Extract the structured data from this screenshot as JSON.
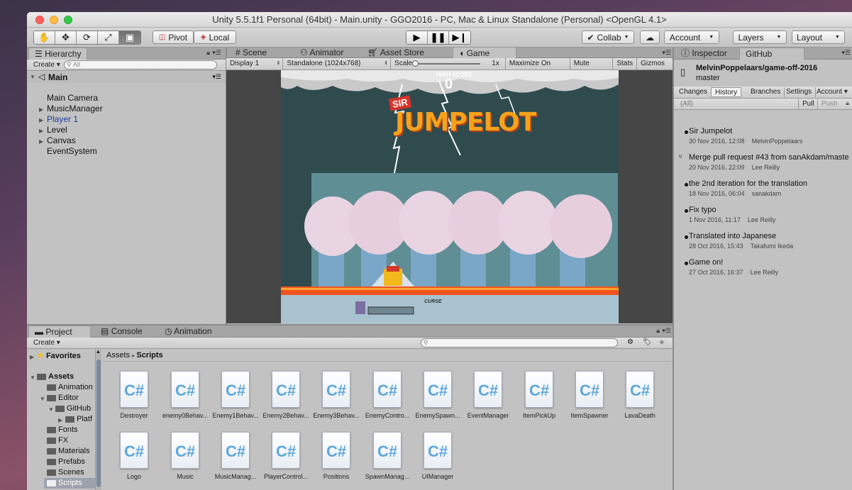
{
  "window": {
    "title": "Unity 5.5.1f1 Personal (64bit) - Main.unity - GGO2016 - PC, Mac & Linux Standalone (Personal) <OpenGL 4.1>"
  },
  "toolbar": {
    "pivot": "Pivot",
    "local": "Local",
    "collab": "Collab",
    "account": "Account",
    "layers": "Layers",
    "layout": "Layout"
  },
  "hierarchy": {
    "tab": "Hierarchy",
    "create": "Create",
    "search_placeholder": "All",
    "scene": "Main",
    "items": [
      {
        "label": "Main Camera"
      },
      {
        "label": "MusicManager"
      },
      {
        "label": "Player 1"
      },
      {
        "label": "Level"
      },
      {
        "label": "Canvas"
      },
      {
        "label": "EventSystem"
      }
    ]
  },
  "center_tabs": {
    "scene": "Scene",
    "animator": "Animator",
    "asset_store": "Asset Store",
    "game": "Game"
  },
  "game_bar": {
    "display": "Display 1",
    "resolution": "Standalone (1024x768)",
    "scale_label": "Scale",
    "scale_value": "1x",
    "maximize": "Maximize On Play",
    "mute": "Mute Audio",
    "stats": "Stats",
    "gizmos": "Gizmos"
  },
  "game_view": {
    "high_score_label": "HIGH SCORE",
    "high_score": "0",
    "title_small": "SIR",
    "title_big": "JUMPELOT",
    "curse_label": "CURSE"
  },
  "right_tabs": {
    "inspector": "Inspector",
    "github": "GitHub"
  },
  "github": {
    "repo": "MelvinPoppelaars/game-off-2016",
    "branch": "master",
    "tabs": [
      "Changes",
      "History",
      "Branches",
      "Settings"
    ],
    "account": "Account",
    "filter": "(All)",
    "pull": "Pull",
    "push": "Push",
    "commits": [
      {
        "message": "Sir Jumpelot",
        "date": "30 Nov 2016, 12:08",
        "author": "MelvinPoppelaars"
      },
      {
        "message": "Merge pull request #43 from sanAkdam/maste",
        "date": "20 Nov 2016, 22:09",
        "author": "Lee Reilly"
      },
      {
        "message": "the 2nd iteration for the translation",
        "date": "18 Nov 2016, 06:04",
        "author": "sanakdam"
      },
      {
        "message": "Fix typo",
        "date": "1 Nov 2016, 11:17",
        "author": "Lee Reilly"
      },
      {
        "message": "Translated into Japanese",
        "date": "28 Oct 2016, 15:43",
        "author": "Takafumi Ikeda"
      },
      {
        "message": "Game on!",
        "date": "27 Oct 2016, 16:37",
        "author": "Lee Reilly"
      }
    ]
  },
  "bottom_tabs": {
    "project": "Project",
    "console": "Console",
    "animation": "Animation"
  },
  "project": {
    "create": "Create",
    "favorites": "Favorites",
    "assets": "Assets",
    "tree": [
      {
        "label": "Animation"
      },
      {
        "label": "Editor"
      },
      {
        "label": "GitHub"
      },
      {
        "label": "Platf"
      },
      {
        "label": "Fonts"
      },
      {
        "label": "FX"
      },
      {
        "label": "Materials"
      },
      {
        "label": "Prefabs"
      },
      {
        "label": "Scenes"
      },
      {
        "label": "Scripts"
      }
    ],
    "breadcrumb": [
      "Assets",
      "Scripts"
    ],
    "files": [
      {
        "name": "Destroyer"
      },
      {
        "name": "enemy0Behav..."
      },
      {
        "name": "Enemy1Behav..."
      },
      {
        "name": "Enemy2Behav..."
      },
      {
        "name": "Enemy3Behav..."
      },
      {
        "name": "EnemyContro..."
      },
      {
        "name": "EnemySpawn..."
      },
      {
        "name": "EventManager"
      },
      {
        "name": "ItemPickUp"
      },
      {
        "name": "ItemSpawner"
      },
      {
        "name": "LavaDeath"
      },
      {
        "name": "Logo"
      },
      {
        "name": "Music"
      },
      {
        "name": "MusicManag..."
      },
      {
        "name": "PlayerControl..."
      },
      {
        "name": "Positions"
      },
      {
        "name": "SpawnManag..."
      },
      {
        "name": "UIManager"
      }
    ],
    "file_icon": "C#"
  }
}
